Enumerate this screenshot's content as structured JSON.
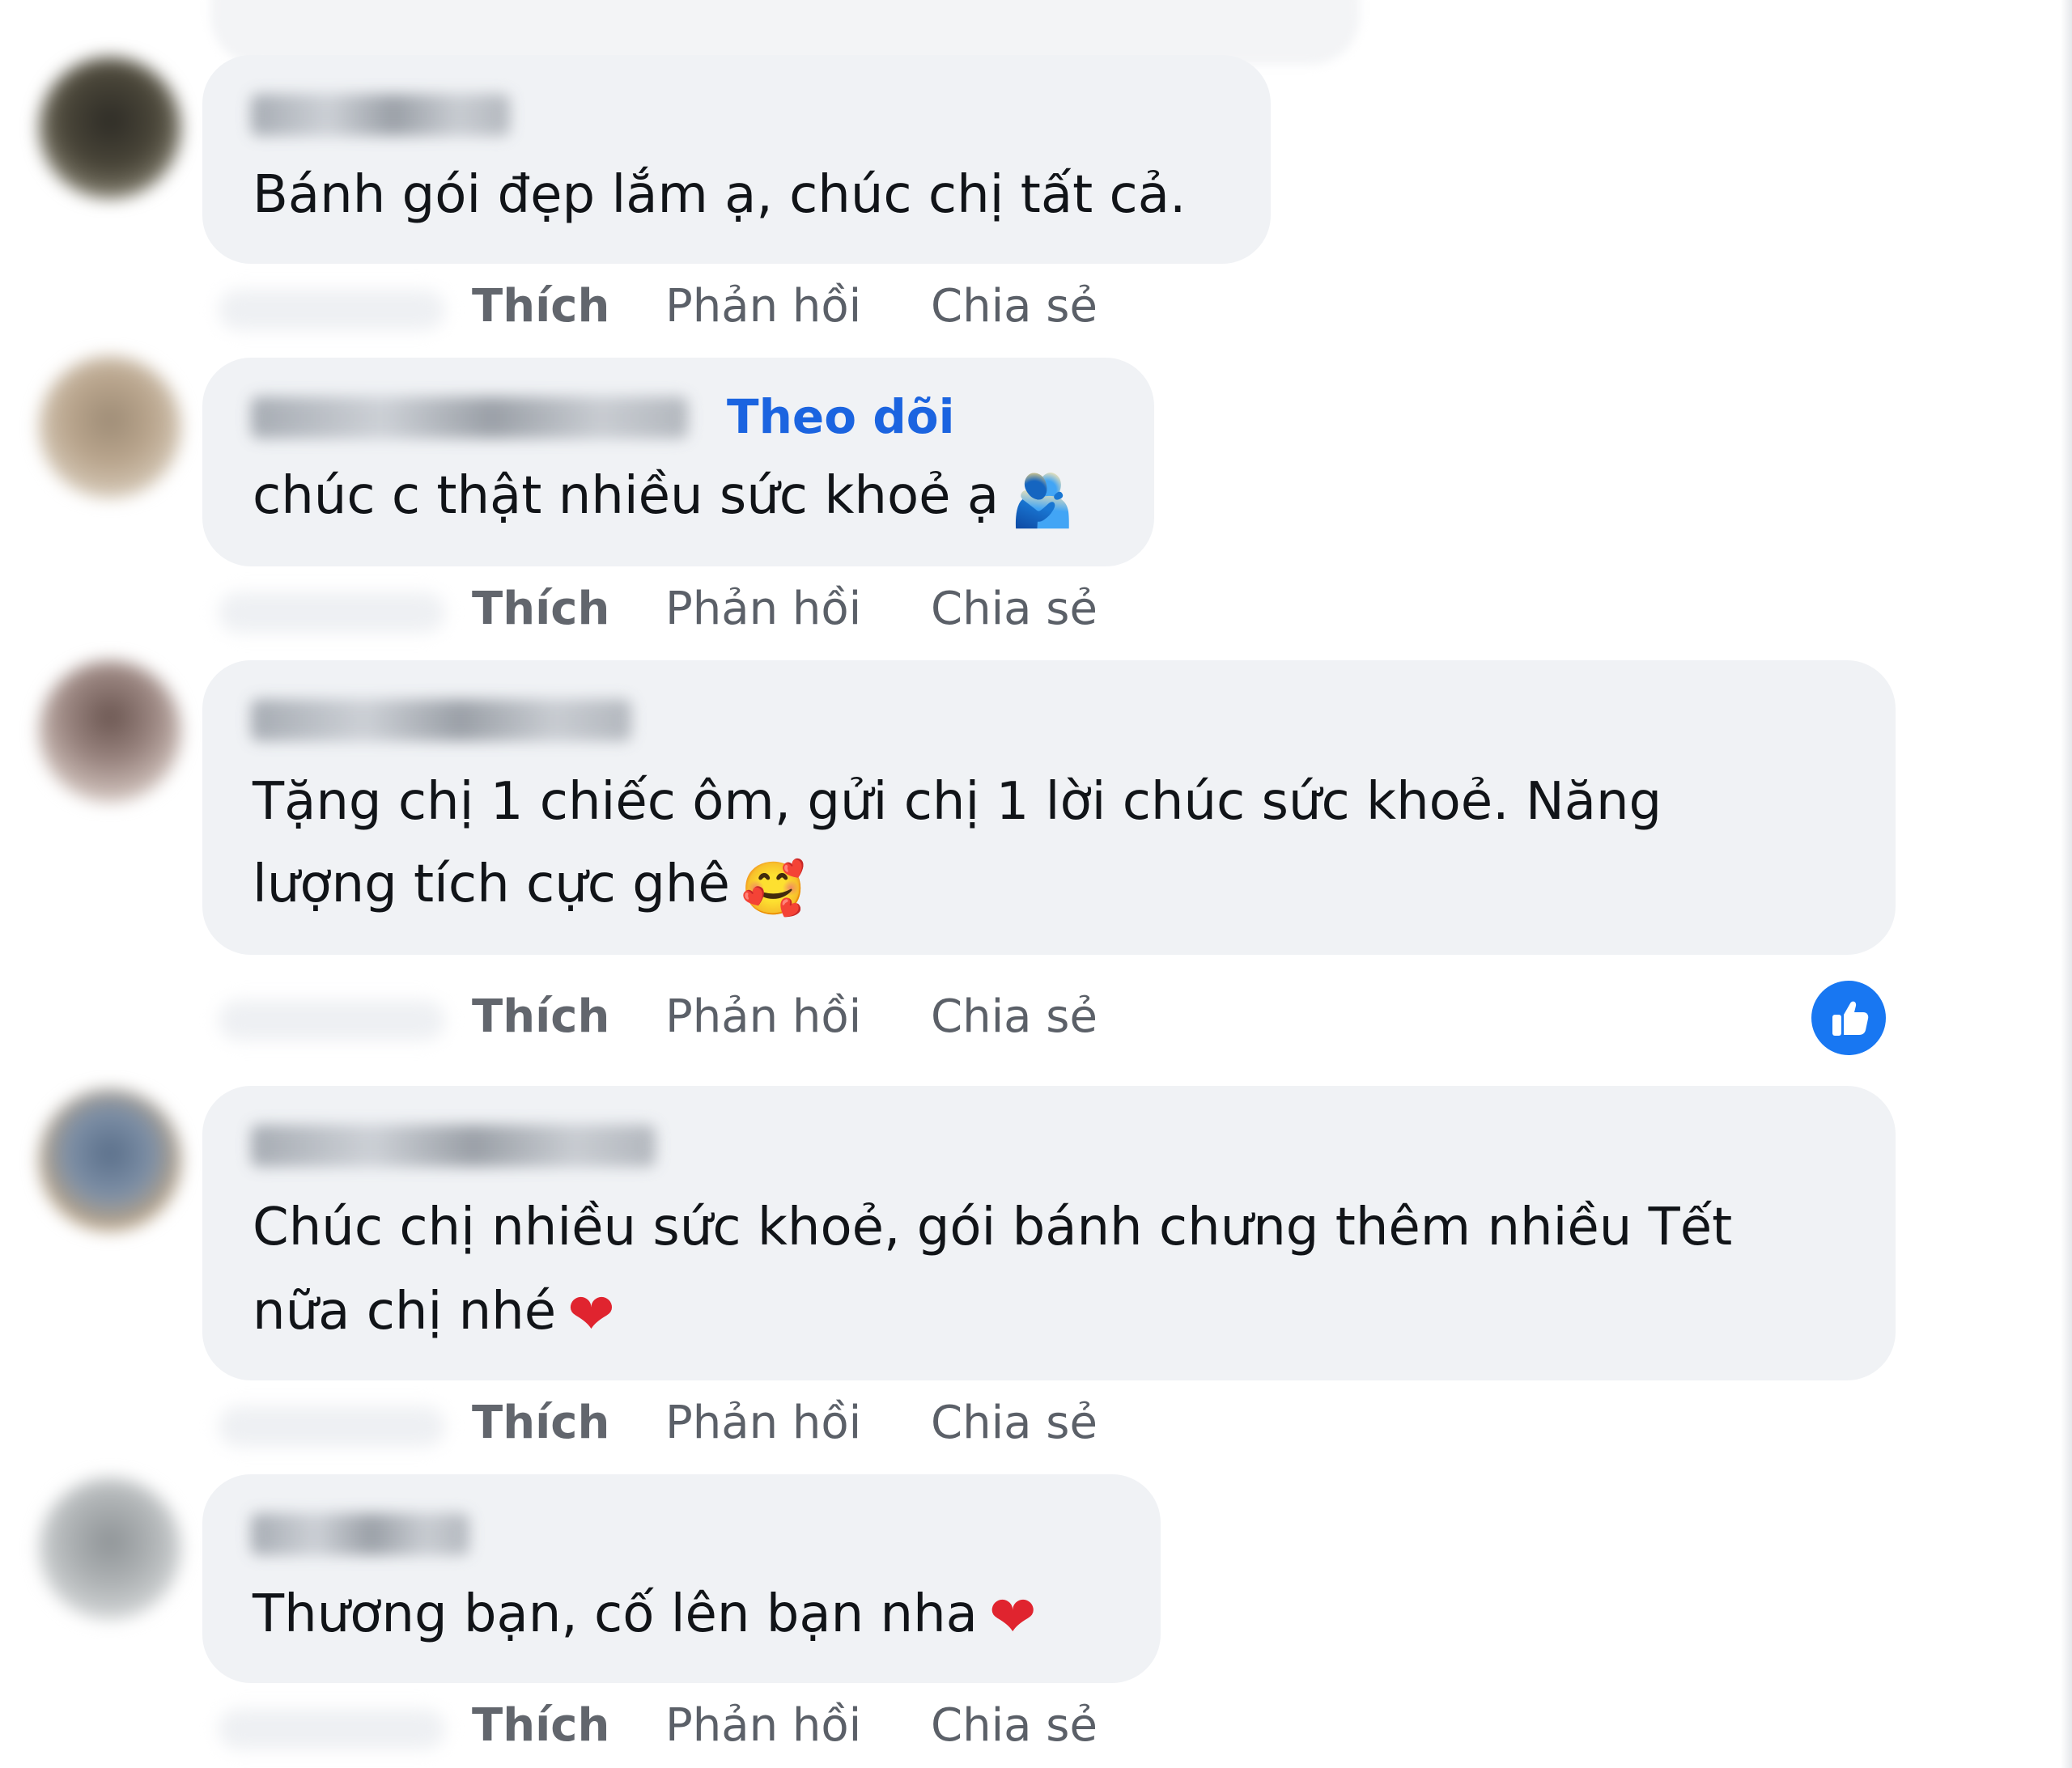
{
  "actions": {
    "like": "Thích",
    "reply": "Phản hồi",
    "share": "Chia sẻ"
  },
  "comments": [
    {
      "text": "Bánh gói đẹp lắm ạ, chúc chị tất cả."
    },
    {
      "follow_label": "Theo dõi",
      "text": "chúc c thật nhiều sức khoẻ ạ",
      "emoji": "🫂"
    },
    {
      "text_line1": "Tặng chị 1 chiếc ôm, gửi chị 1 lời chúc sức khoẻ. Năng",
      "text_line2": "lượng tích cực ghê",
      "emoji": "🥰",
      "reaction_icon": "like-thumb-icon"
    },
    {
      "text_line1": "Chúc chị nhiều sức khoẻ, gói bánh chưng thêm nhiều Tết",
      "text_line2": "nữa chị nhé",
      "emoji": "❤"
    },
    {
      "text": "Thương bạn, cố lên bạn nha",
      "emoji": "❤"
    }
  ],
  "colors": {
    "bubble": "#f0f2f5",
    "follow": "#1b64e0",
    "like_reaction": "#1877f2",
    "heart": "#e0242f"
  }
}
